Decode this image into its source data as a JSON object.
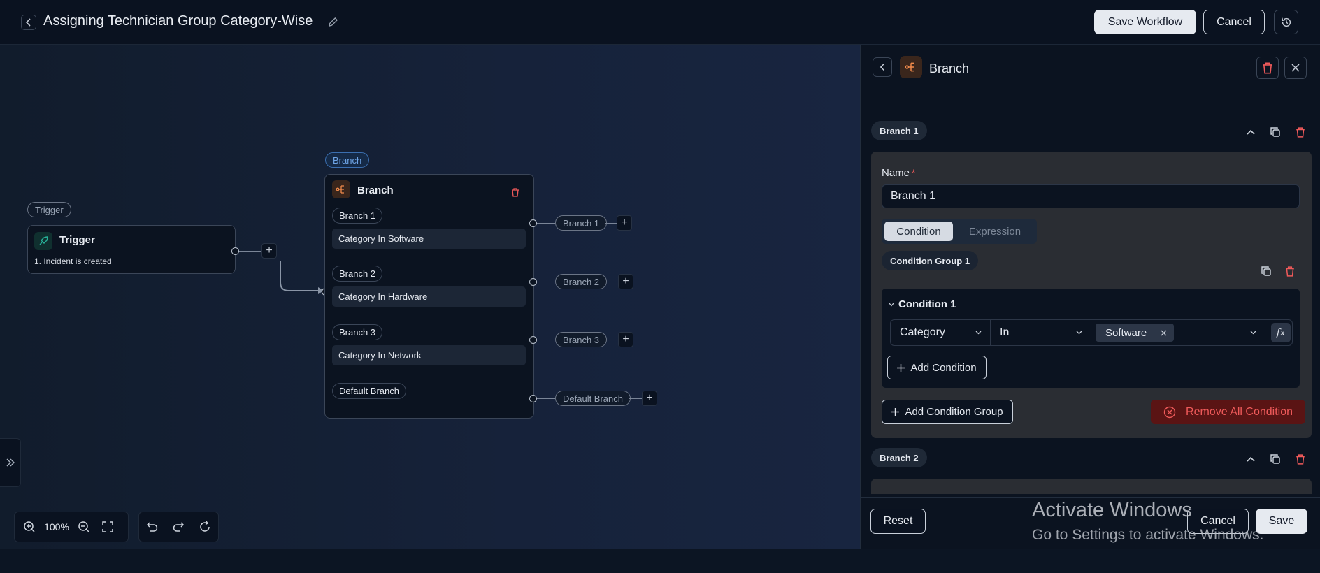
{
  "header": {
    "title": "Assigning Technician Group Category-Wise",
    "save_workflow": "Save Workflow",
    "cancel": "Cancel"
  },
  "canvas": {
    "trigger_tag": "Trigger",
    "trigger_node": {
      "title": "Trigger",
      "event": "1. Incident is created"
    },
    "branch_tag": "Branch",
    "branch_node": {
      "title": "Branch",
      "rows": [
        {
          "label": "Branch 1",
          "condition": "Category In Software",
          "out": "Branch 1"
        },
        {
          "label": "Branch 2",
          "condition": "Category In Hardware",
          "out": "Branch 2"
        },
        {
          "label": "Branch 3",
          "condition": "Category In Network",
          "out": "Branch 3"
        }
      ],
      "default_label": "Default Branch",
      "default_out": "Default Branch"
    },
    "zoom": "100%"
  },
  "panel": {
    "title": "Branch",
    "branch1_pill": "Branch 1",
    "name_label": "Name",
    "required_mark": "*",
    "name_value": "Branch 1",
    "tab_condition": "Condition",
    "tab_expression": "Expression",
    "group_pill": "Condition Group 1",
    "condition_title": "Condition 1",
    "field": "Category",
    "operator": "In",
    "value_tag": "Software",
    "fx_label": "fx",
    "add_condition": "Add Condition",
    "add_condition_group": "Add Condition Group",
    "remove_all": "Remove All Condition",
    "branch2_pill": "Branch 2",
    "reset": "Reset",
    "cancel": "Cancel",
    "save": "Save"
  },
  "watermark": {
    "line1": "Activate Windows",
    "line2": "Go to Settings to activate Windows."
  },
  "colors": {
    "accent_orange": "#f08a4b",
    "danger": "#ef5a5a",
    "trigger_green": "#27b39a",
    "link_blue": "#6fa5e6"
  }
}
